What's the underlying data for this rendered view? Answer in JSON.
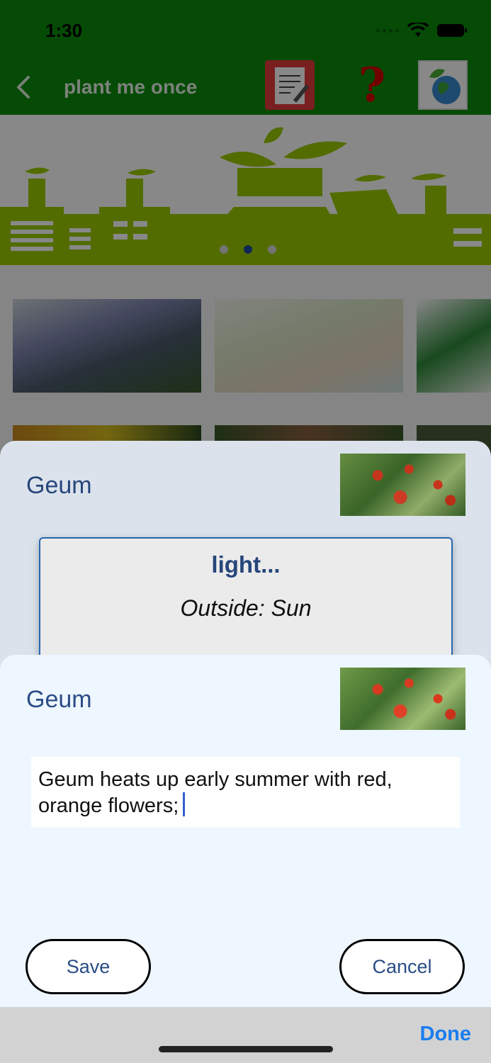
{
  "status": {
    "time": "1:30"
  },
  "nav": {
    "title": "plant me once"
  },
  "colors": {
    "accent": "#0b8e0b",
    "link": "#2a4d86",
    "done": "#1a7cf0"
  },
  "banner": {
    "pages": 3,
    "active_page": 2
  },
  "card_sheet": {
    "plant_name": "Geum",
    "heading": "light...",
    "subheading": "Outside: Sun"
  },
  "note_sheet": {
    "plant_name": "Geum",
    "note_text": "Geum heats up early summer with red, orange flowers;",
    "save_label": "Save",
    "cancel_label": "Cancel"
  },
  "keyboard_toolbar": {
    "done_label": "Done"
  }
}
